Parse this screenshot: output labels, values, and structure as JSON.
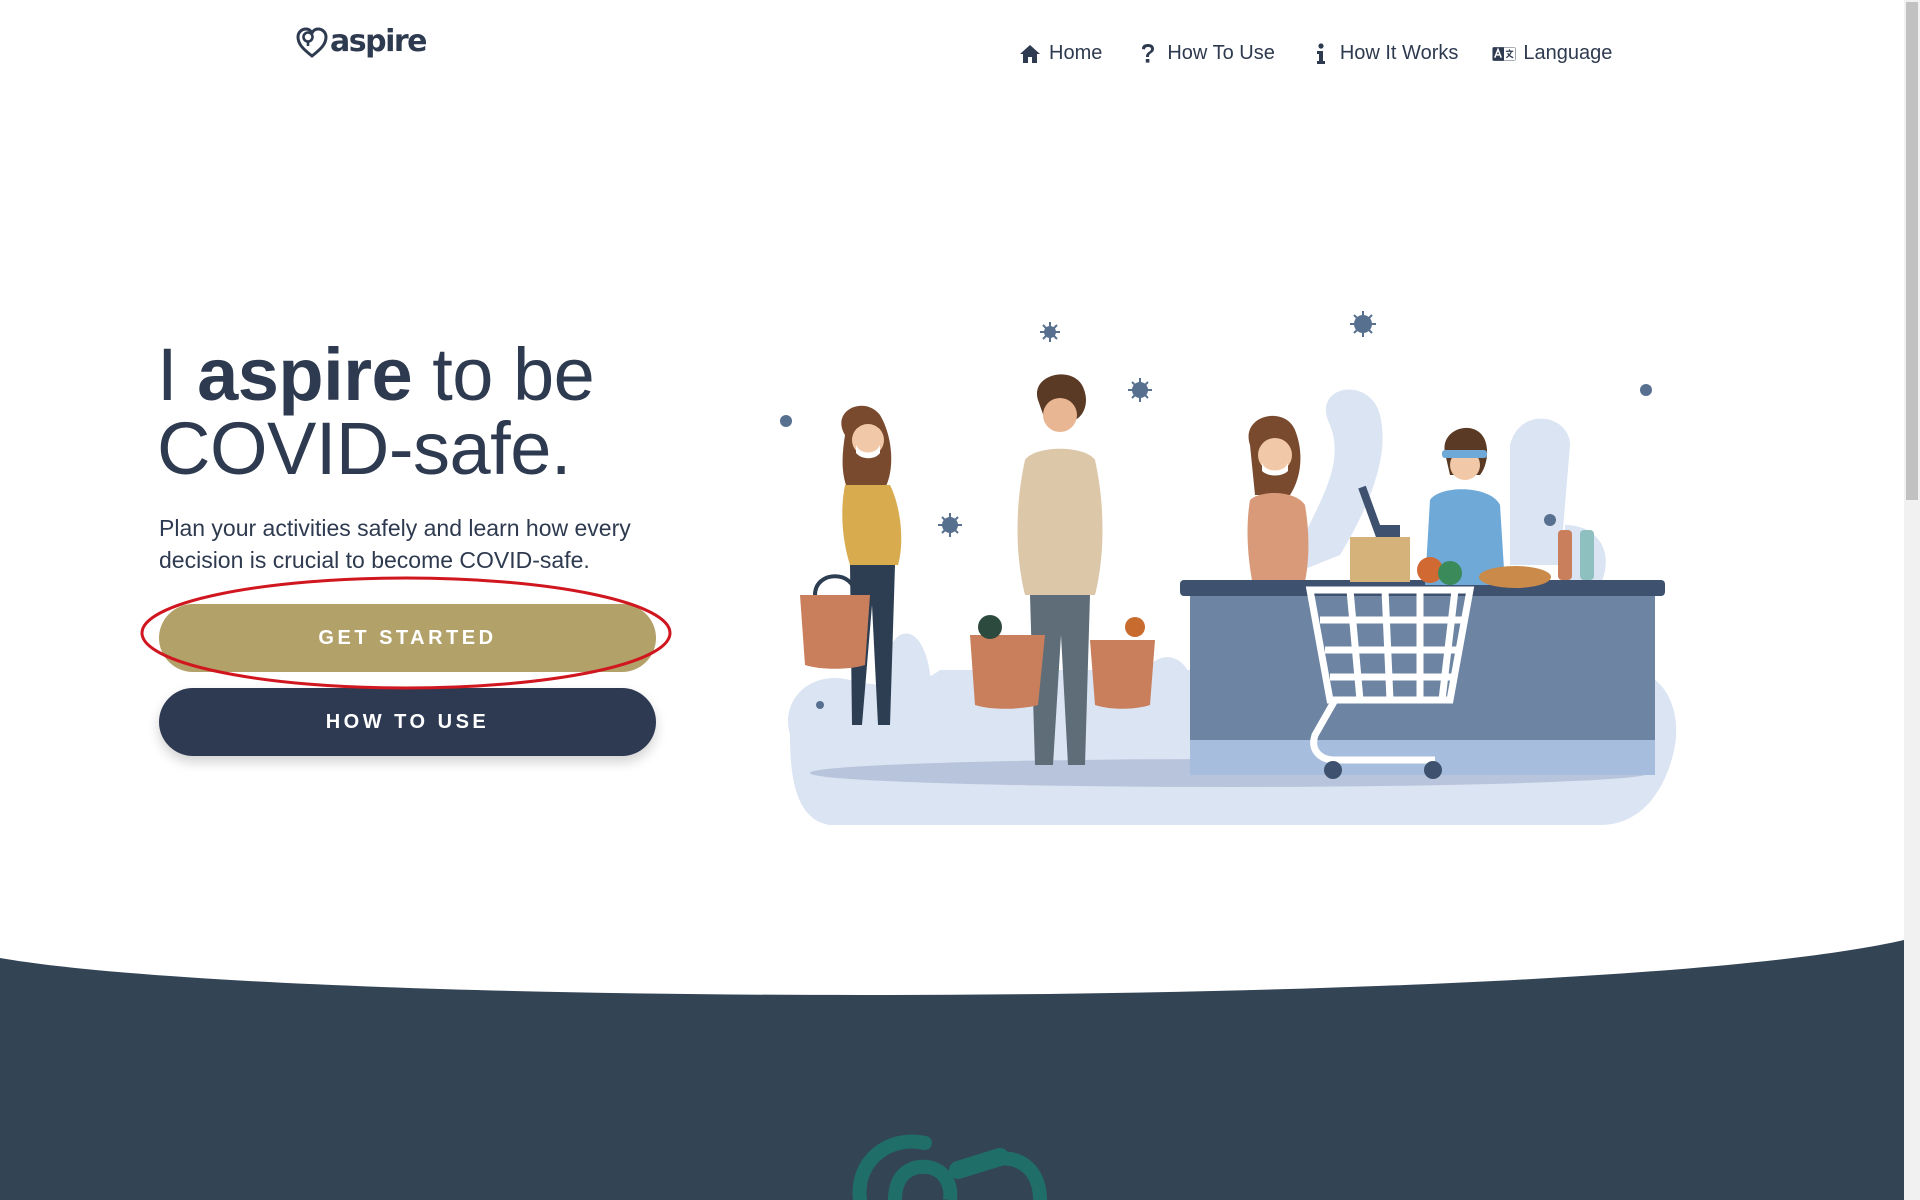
{
  "brand": {
    "name": "aspire",
    "logo_icon": "heart-pin-icon"
  },
  "nav": {
    "items": [
      {
        "label": "Home",
        "icon": "home-icon"
      },
      {
        "label": "How To Use",
        "icon": "question-icon"
      },
      {
        "label": "How It Works",
        "icon": "info-icon"
      },
      {
        "label": "Language",
        "icon": "language-icon"
      }
    ]
  },
  "hero": {
    "title_line1_prefix": "I ",
    "title_line1_bold": "aspire",
    "title_line1_suffix": " to be",
    "title_line2": "COVID-safe.",
    "subtitle": "Plan your activities safely and learn how every decision is crucial to become COVID-safe.",
    "primary_button": "GET STARTED",
    "secondary_button": "HOW TO USE"
  },
  "colors": {
    "text": "#2e3a4f",
    "primary_button": "#b2a168",
    "secondary_button": "#2e3a52",
    "bottom_band": "#334455",
    "annotation": "#d0161f",
    "illustration_blob": "#dbe4f3"
  }
}
